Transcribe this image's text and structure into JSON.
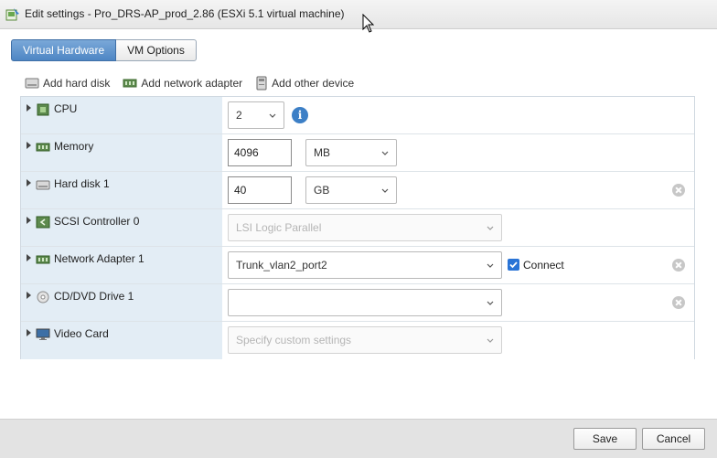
{
  "window": {
    "title": "Edit settings - Pro_DRS-AP_prod_2.86 (ESXi 5.1 virtual machine)"
  },
  "tabs": [
    {
      "label": "Virtual Hardware",
      "active": true
    },
    {
      "label": "VM Options",
      "active": false
    }
  ],
  "toolbar": {
    "add_hard_disk": "Add hard disk",
    "add_network_adapter": "Add network adapter",
    "add_other_device": "Add other device"
  },
  "devices": {
    "cpu": {
      "label": "CPU",
      "value": "2"
    },
    "memory": {
      "label": "Memory",
      "value": "4096",
      "unit": "MB"
    },
    "hard_disk": {
      "label": "Hard disk 1",
      "value": "40",
      "unit": "GB"
    },
    "scsi": {
      "label": "SCSI Controller 0",
      "value": "LSI Logic Parallel"
    },
    "network": {
      "label": "Network Adapter 1",
      "value": "Trunk_vlan2_port2",
      "connect_label": "Connect",
      "connected": true
    },
    "cdrom": {
      "label": "CD/DVD Drive 1",
      "value": ""
    },
    "video": {
      "label": "Video Card",
      "value": "Specify custom settings"
    }
  },
  "footer": {
    "save_label": "Save",
    "cancel_label": "Cancel"
  },
  "colors": {
    "accent": "#4e86c4",
    "label_column": "#e3edf5",
    "checkbox": "#2a74d6",
    "info": "#3c7fc6"
  }
}
